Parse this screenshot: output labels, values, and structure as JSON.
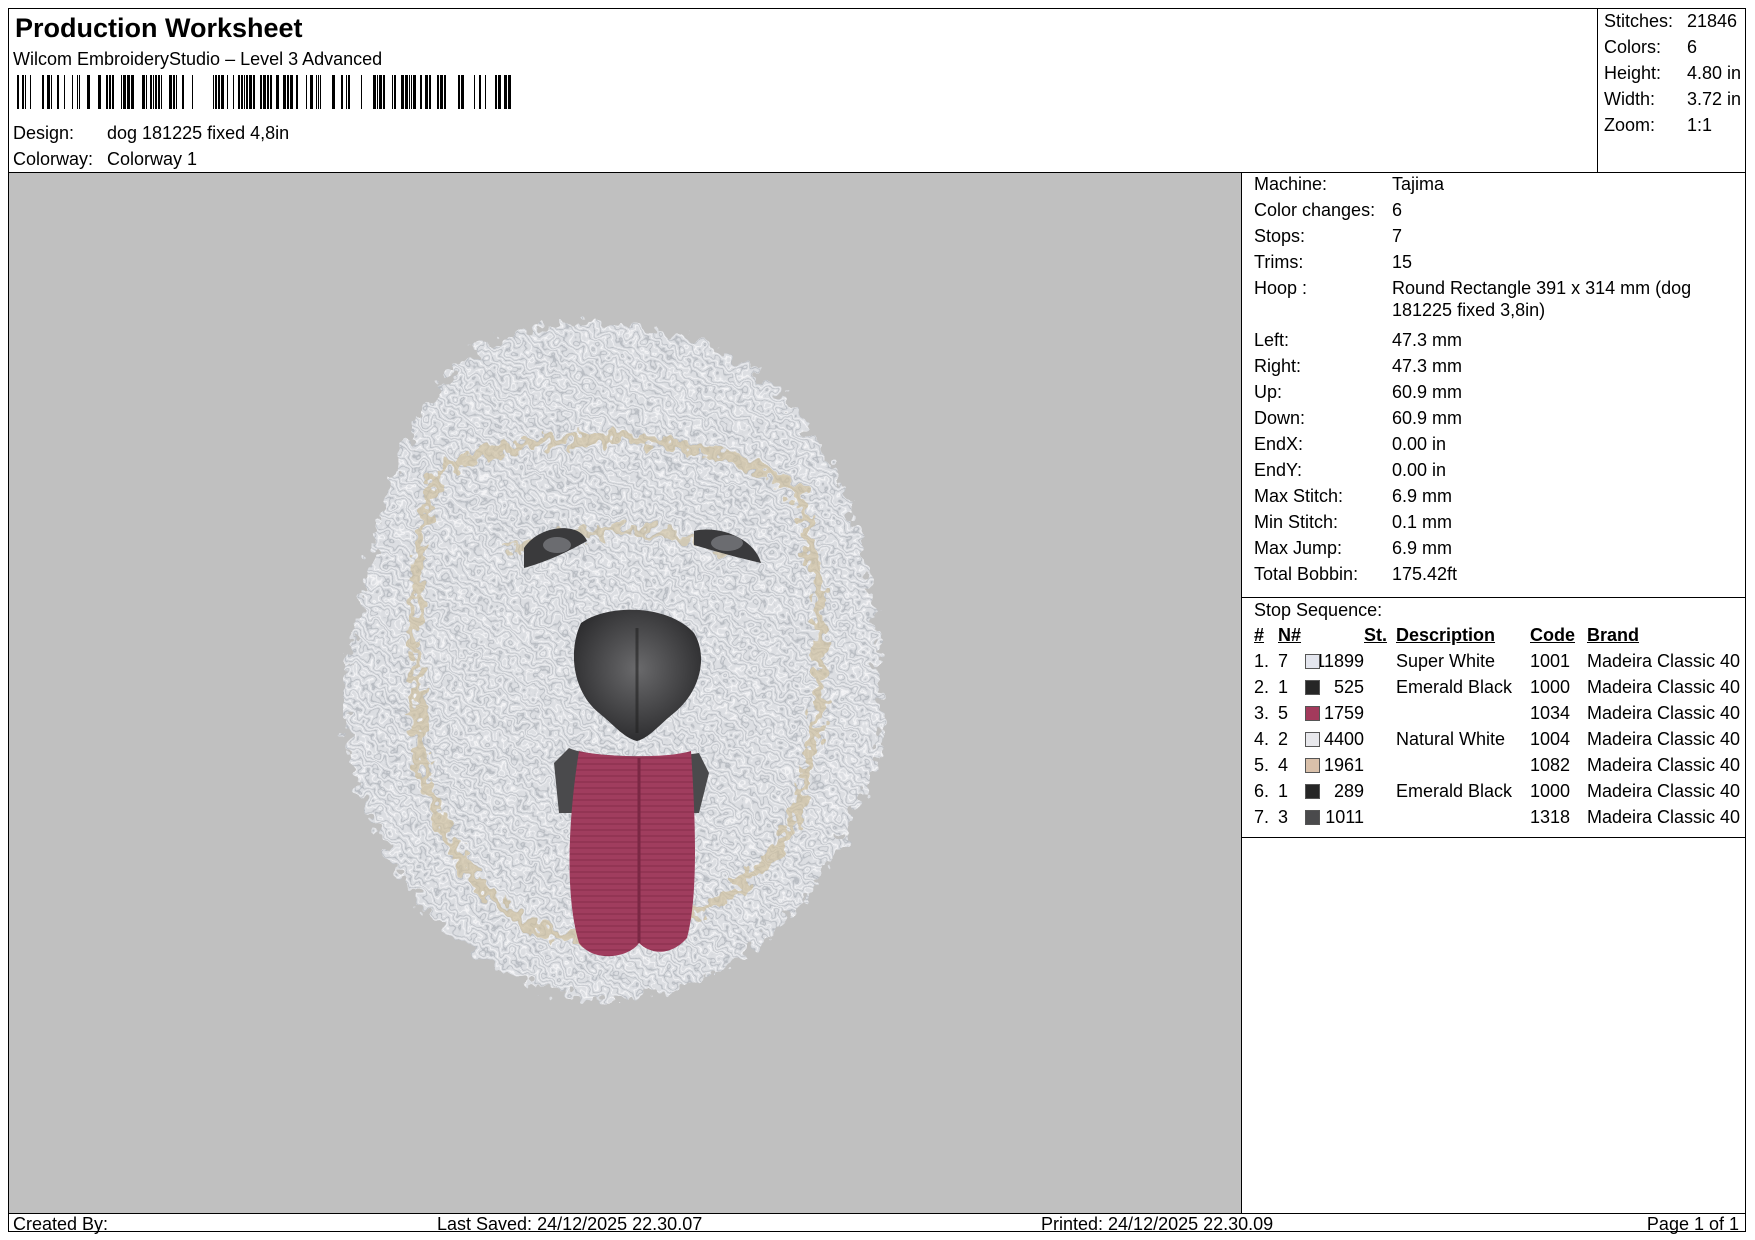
{
  "header": {
    "title": "Production Worksheet",
    "software": "Wilcom EmbroideryStudio – Level 3 Advanced",
    "design_label": "Design:",
    "design_value": "dog 181225 fixed 4,8in",
    "colorway_label": "Colorway:",
    "colorway_value": "Colorway 1"
  },
  "stats": [
    {
      "label": "Stitches:",
      "value": "21846"
    },
    {
      "label": "Colors:",
      "value": "6"
    },
    {
      "label": "Height:",
      "value": "4.80 in"
    },
    {
      "label": "Width:",
      "value": "3.72 in"
    },
    {
      "label": "Zoom:",
      "value": "1:1"
    }
  ],
  "info": [
    {
      "label": "Machine:",
      "value": "Tajima"
    },
    {
      "label": "Color changes:",
      "value": "6"
    },
    {
      "label": "Stops:",
      "value": "7"
    },
    {
      "label": "Trims:",
      "value": "15"
    },
    {
      "label": "Hoop :",
      "value": "Round Rectangle 391 x 314 mm (dog 181225 fixed 3,8in)"
    },
    {
      "label": "Left:",
      "value": "47.3 mm"
    },
    {
      "label": "Right:",
      "value": "47.3 mm"
    },
    {
      "label": "Up:",
      "value": "60.9 mm"
    },
    {
      "label": "Down:",
      "value": "60.9 mm"
    },
    {
      "label": "EndX:",
      "value": "0.00 in"
    },
    {
      "label": "EndY:",
      "value": "0.00 in"
    },
    {
      "label": "Max Stitch:",
      "value": "6.9 mm"
    },
    {
      "label": "Min Stitch:",
      "value": "0.1 mm"
    },
    {
      "label": "Max Jump:",
      "value": "6.9 mm"
    },
    {
      "label": "Total Bobbin:",
      "value": "175.42ft"
    }
  ],
  "stop_sequence": {
    "title": "Stop Sequence:",
    "headers": {
      "num": "#",
      "n": "N#",
      "st": "St.",
      "desc": "Description",
      "code": "Code",
      "brand": "Brand"
    },
    "rows": [
      {
        "num": "1.",
        "n": "7",
        "color": "#e4e6ee",
        "st": "11899",
        "desc": "Super White",
        "code": "1001",
        "brand": "Madeira Classic 40"
      },
      {
        "num": "2.",
        "n": "1",
        "color": "#262626",
        "st": "525",
        "desc": "Emerald Black",
        "code": "1000",
        "brand": "Madeira Classic 40"
      },
      {
        "num": "3.",
        "n": "5",
        "color": "#a33a5c",
        "st": "1759",
        "desc": "",
        "code": "1034",
        "brand": "Madeira Classic 40"
      },
      {
        "num": "4.",
        "n": "2",
        "color": "#e8e8ec",
        "st": "4400",
        "desc": "Natural White",
        "code": "1004",
        "brand": "Madeira Classic 40"
      },
      {
        "num": "5.",
        "n": "4",
        "color": "#d9c0aa",
        "st": "1961",
        "desc": "",
        "code": "1082",
        "brand": "Madeira Classic 40"
      },
      {
        "num": "6.",
        "n": "1",
        "color": "#262626",
        "st": "289",
        "desc": "Emerald Black",
        "code": "1000",
        "brand": "Madeira Classic 40"
      },
      {
        "num": "7.",
        "n": "3",
        "color": "#4a4a4c",
        "st": "1011",
        "desc": "",
        "code": "1318",
        "brand": "Madeira Classic 40"
      }
    ]
  },
  "footer": {
    "created_by": "Created By:",
    "last_saved": "Last Saved: 24/12/2025 22.30.07",
    "printed": "Printed: 24/12/2025 22.30.09",
    "page": "Page 1 of 1"
  },
  "colors": {
    "preview_background": "#c0c0c0"
  }
}
